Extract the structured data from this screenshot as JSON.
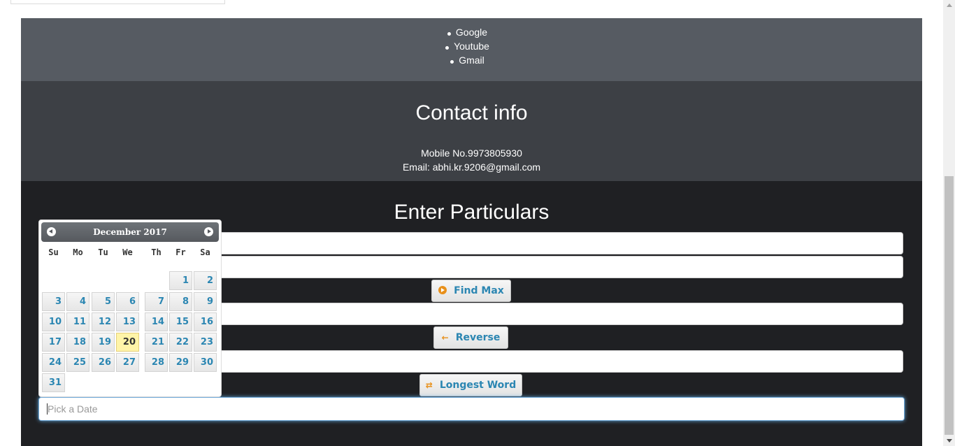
{
  "links": [
    "Google",
    "Youtube",
    "Gmail"
  ],
  "contact": {
    "title": "Contact info",
    "mobile": "Mobile No.9973805930",
    "email": "Email: abhi.kr.9206@gmail.com"
  },
  "particulars": {
    "title": "Enter Particulars",
    "find_max_label": "Find Max",
    "reverse_label": "Reverse",
    "longest_word_label": "Longest Word",
    "date_placeholder": "Pick a Date"
  },
  "datepicker": {
    "month_label": "December 2017",
    "weekdays": [
      "Su",
      "Mo",
      "Tu",
      "We",
      "Th",
      "Fr",
      "Sa"
    ],
    "first_weekday_index": 5,
    "days_in_month": 31,
    "today": 20
  },
  "colors": {
    "links_bg": "#565b62",
    "contact_bg": "#3d4045",
    "particulars_bg": "#1f2023",
    "button_text": "#2b86b2",
    "button_icon": "#e8901a",
    "today_highlight": "#fff4a8"
  },
  "icons": {
    "find_max": "circle-play-icon",
    "reverse": "arrow-left-icon",
    "longest_word": "swap-arrows-icon",
    "prev_month": "circle-arrow-left-icon",
    "next_month": "circle-arrow-right-icon"
  }
}
